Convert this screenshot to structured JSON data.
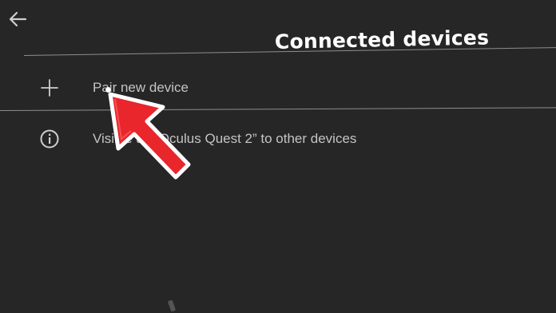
{
  "header": {
    "title": "Connected devices",
    "back_icon": "arrow-left-icon"
  },
  "rows": [
    {
      "icon": "plus-icon",
      "label": "Pair new device"
    },
    {
      "icon": "info-icon",
      "label": "Visible as “Oculus Quest 2” to other devices"
    }
  ],
  "overlay": {
    "arrow_color": "#e8262b",
    "arrow_outline": "#ffffff"
  },
  "colors": {
    "background": "#262626",
    "title": "#ffffff",
    "text": "#c4c4c4",
    "divider": "#8e8e8e"
  }
}
